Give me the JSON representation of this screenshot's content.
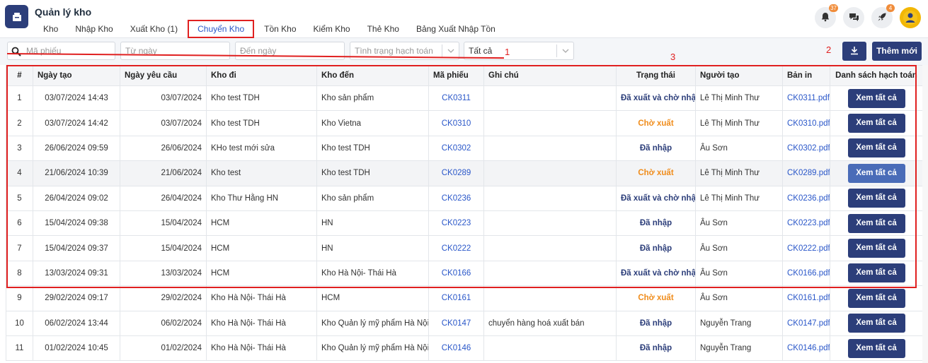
{
  "app": {
    "title": "Quản lý kho"
  },
  "nav": [
    {
      "label": "Kho",
      "active": false
    },
    {
      "label": "Nhập Kho",
      "active": false
    },
    {
      "label": "Xuất Kho (1)",
      "active": false
    },
    {
      "label": "Chuyển Kho",
      "active": true
    },
    {
      "label": "Tồn Kho",
      "active": false
    },
    {
      "label": "Kiểm Kho",
      "active": false
    },
    {
      "label": "Thẻ Kho",
      "active": false
    },
    {
      "label": "Bảng Xuất Nhập Tồn",
      "active": false
    }
  ],
  "header_icons": {
    "notifications_badge": "37",
    "rocket_badge": "4",
    "icons": [
      "bell-icon",
      "chat-icon",
      "rocket-icon",
      "avatar"
    ]
  },
  "filters": {
    "ma_phieu_placeholder": "Mã phiếu",
    "tu_ngay_placeholder": "Từ ngày",
    "den_ngay_placeholder": "Đến ngày",
    "tinh_trang_placeholder": "Tình trạng hạch toán",
    "tat_ca_value": "Tất cả"
  },
  "annotations": {
    "a1": "1",
    "a2": "2",
    "a3": "3"
  },
  "toolbar": {
    "add_label": "Thêm mới"
  },
  "colors": {
    "primary": "#2c3e7a",
    "accent_red": "#e02020",
    "link": "#2a57c9",
    "warning": "#f08c1a"
  },
  "table": {
    "headers": [
      "#",
      "Ngày tạo",
      "Ngày yêu cầu",
      "Kho đi",
      "Kho đến",
      "Mã phiếu",
      "Ghi chú",
      "Trạng thái",
      "Người tạo",
      "Bản in",
      "Danh sách hạch toán"
    ],
    "rows": [
      {
        "no": "1",
        "created": "03/07/2024 14:43",
        "requested": "03/07/2024",
        "from": "Kho test TDH",
        "to": "Kho sản phẩm",
        "code": "CK0311",
        "note": "",
        "status": "Đã xuất và chờ nhập",
        "status_type": "done",
        "creator": "Lê Thị Minh Thư",
        "print": "CK0311.pdf",
        "action": "Xem tất cả"
      },
      {
        "no": "2",
        "created": "03/07/2024 14:42",
        "requested": "03/07/2024",
        "from": "Kho test TDH",
        "to": "Kho Vietna",
        "code": "CK0310",
        "note": "",
        "status": "Chờ xuất",
        "status_type": "wait",
        "creator": "Lê Thị Minh Thư",
        "print": "CK0310.pdf",
        "action": "Xem tất cả"
      },
      {
        "no": "3",
        "created": "26/06/2024 09:59",
        "requested": "26/06/2024",
        "from": "KHo test mới sửa",
        "to": "Kho test TDH",
        "code": "CK0302",
        "note": "",
        "status": "Đã nhập",
        "status_type": "done",
        "creator": "Âu Sơn",
        "print": "CK0302.pdf",
        "action": "Xem tất cả"
      },
      {
        "no": "4",
        "created": "21/06/2024 10:39",
        "requested": "21/06/2024",
        "from": "Kho test",
        "to": "Kho test TDH",
        "code": "CK0289",
        "note": "",
        "status": "Chờ xuất",
        "status_type": "wait",
        "creator": "Lê Thị Minh Thư",
        "print": "CK0289.pdf",
        "action": "Xem tất cả"
      },
      {
        "no": "5",
        "created": "26/04/2024 09:02",
        "requested": "26/04/2024",
        "from": "Kho Thư Hằng HN",
        "to": "Kho sản phẩm",
        "code": "CK0236",
        "note": "",
        "status": "Đã xuất và chờ nhập",
        "status_type": "done",
        "creator": "Lê Thị Minh Thư",
        "print": "CK0236.pdf",
        "action": "Xem tất cả"
      },
      {
        "no": "6",
        "created": "15/04/2024 09:38",
        "requested": "15/04/2024",
        "from": "HCM",
        "to": "HN",
        "code": "CK0223",
        "note": "",
        "status": "Đã nhập",
        "status_type": "done",
        "creator": "Âu Sơn",
        "print": "CK0223.pdf",
        "action": "Xem tất cả"
      },
      {
        "no": "7",
        "created": "15/04/2024 09:37",
        "requested": "15/04/2024",
        "from": "HCM",
        "to": "HN",
        "code": "CK0222",
        "note": "",
        "status": "Đã nhập",
        "status_type": "done",
        "creator": "Âu Sơn",
        "print": "CK0222.pdf",
        "action": "Xem tất cả"
      },
      {
        "no": "8",
        "created": "13/03/2024 09:31",
        "requested": "13/03/2024",
        "from": "HCM",
        "to": "Kho Hà Nội- Thái Hà",
        "code": "CK0166",
        "note": "",
        "status": "Đã xuất và chờ nhập",
        "status_type": "done",
        "creator": "Âu Sơn",
        "print": "CK0166.pdf",
        "action": "Xem tất cả"
      },
      {
        "no": "9",
        "created": "29/02/2024 09:17",
        "requested": "29/02/2024",
        "from": "Kho Hà Nội- Thái Hà",
        "to": "HCM",
        "code": "CK0161",
        "note": "",
        "status": "Chờ xuất",
        "status_type": "wait",
        "creator": "Âu Sơn",
        "print": "CK0161.pdf",
        "action": "Xem tất cả"
      },
      {
        "no": "10",
        "created": "06/02/2024 13:44",
        "requested": "06/02/2024",
        "from": "Kho Hà Nội- Thái Hà",
        "to": "Kho Quản lý mỹ phẩm Hà Nội",
        "code": "CK0147",
        "note": "chuyển hàng hoá xuất bán",
        "status": "Đã nhập",
        "status_type": "done",
        "creator": "Nguyễn Trang",
        "print": "CK0147.pdf",
        "action": "Xem tất cả"
      },
      {
        "no": "11",
        "created": "01/02/2024 10:45",
        "requested": "01/02/2024",
        "from": "Kho Hà Nội- Thái Hà",
        "to": "Kho Quản lý mỹ phẩm Hà Nội",
        "code": "CK0146",
        "note": "",
        "status": "Đã nhập",
        "status_type": "done",
        "creator": "Nguyễn Trang",
        "print": "CK0146.pdf",
        "action": "Xem tất cả"
      }
    ]
  }
}
